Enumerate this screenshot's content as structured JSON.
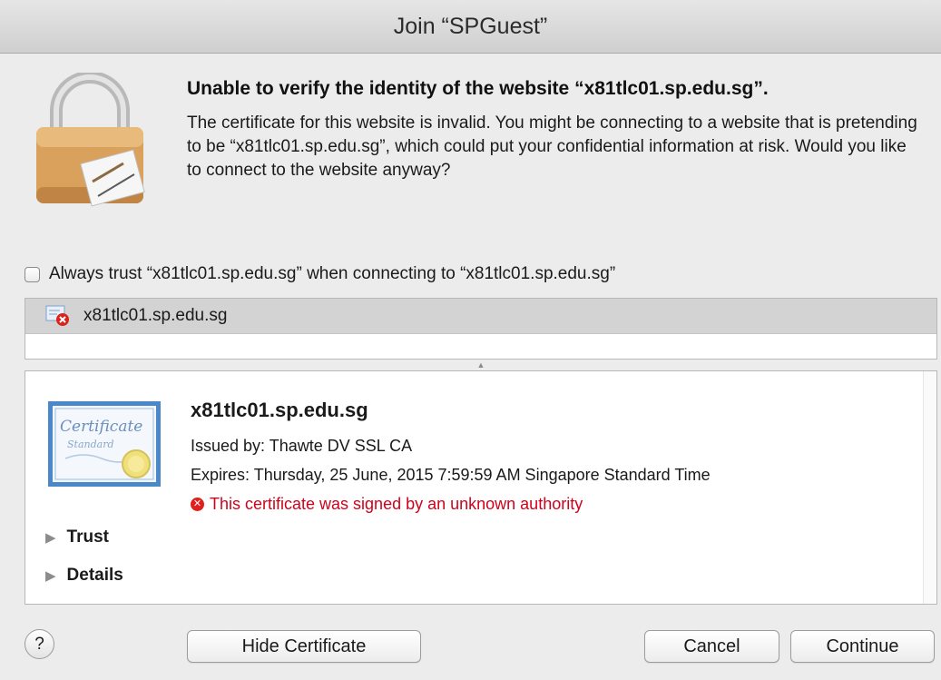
{
  "window": {
    "title": "Join “SPGuest”"
  },
  "alert": {
    "headline": "Unable to verify the identity of the website “x81tlc01.sp.edu.sg”.",
    "message": "The certificate for this website is invalid. You might be connecting to a website that is pretending to be “x81tlc01.sp.edu.sg”, which could put your confidential information at risk. Would you like to connect to the website anyway?"
  },
  "trust_checkbox": {
    "label": "Always trust “x81tlc01.sp.edu.sg” when connecting to “x81tlc01.sp.edu.sg”",
    "checked": false
  },
  "cert_list": {
    "items": [
      {
        "name": "x81tlc01.sp.edu.sg",
        "status": "invalid"
      }
    ]
  },
  "certificate": {
    "name": "x81tlc01.sp.edu.sg",
    "issued_by": "Issued by: Thawte DV SSL CA",
    "expires": "Expires: Thursday, 25 June, 2015 7:59:59 AM Singapore Standard Time",
    "warning": "This certificate was signed by an unknown authority",
    "image_text_1": "Certificate",
    "image_text_2": "Standard"
  },
  "sections": [
    {
      "label": "Trust",
      "expanded": false
    },
    {
      "label": "Details",
      "expanded": false
    }
  ],
  "buttons": {
    "help": "?",
    "hide_certificate": "Hide Certificate",
    "cancel": "Cancel",
    "continue": "Continue"
  },
  "colors": {
    "warning": "#d0021b",
    "error_badge": "#e0201f"
  }
}
